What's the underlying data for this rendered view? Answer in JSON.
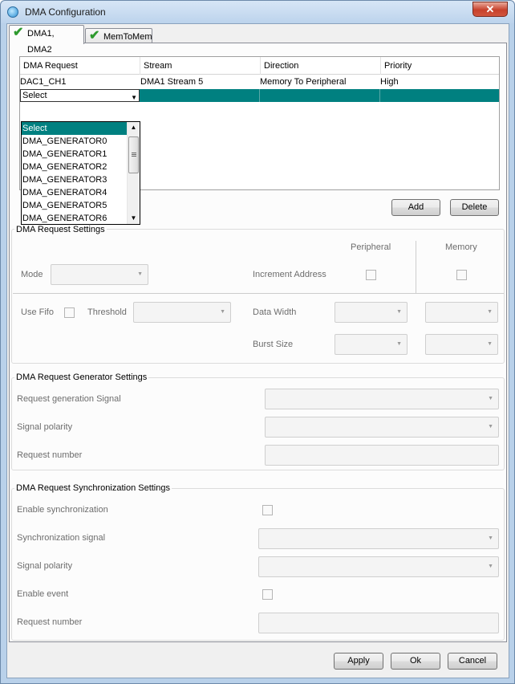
{
  "window": {
    "title": "DMA Configuration",
    "close_glyph": "✕"
  },
  "tabs": [
    {
      "label": "DMA1, DMA2",
      "icon": "check-icon",
      "active": true
    },
    {
      "label": "MemToMem",
      "icon": "check-icon",
      "active": false
    }
  ],
  "table": {
    "headers": [
      "DMA Request",
      "Stream",
      "Direction",
      "Priority"
    ],
    "rows": [
      {
        "request": "DAC1_CH1",
        "stream": "DMA1 Stream 5",
        "direction": "Memory To Peripheral",
        "priority": "High"
      }
    ],
    "editing_row": {
      "combo_value": "Select"
    }
  },
  "dropdown": {
    "options": [
      "Select",
      "DMA_GENERATOR0",
      "DMA_GENERATOR1",
      "DMA_GENERATOR2",
      "DMA_GENERATOR3",
      "DMA_GENERATOR4",
      "DMA_GENERATOR5",
      "DMA_GENERATOR6"
    ],
    "selected": "Select"
  },
  "table_buttons": {
    "add": "Add",
    "delete": "Delete"
  },
  "request_settings": {
    "title": "DMA Request Settings",
    "peripheral_header": "Peripheral",
    "memory_header": "Memory",
    "mode_label": "Mode",
    "increment_label": "Increment Address",
    "use_fifo_label": "Use Fifo",
    "threshold_label": "Threshold",
    "data_width_label": "Data Width",
    "burst_size_label": "Burst Size"
  },
  "generator_settings": {
    "title": "DMA Request Generator Settings",
    "signal_label": "Request generation Signal",
    "polarity_label": "Signal polarity",
    "number_label": "Request number"
  },
  "sync_settings": {
    "title": "DMA Request Synchronization Settings",
    "enable_sync_label": "Enable synchronization",
    "sync_signal_label": "Synchronization signal",
    "polarity_label": "Signal polarity",
    "enable_event_label": "Enable event",
    "number_label": "Request number"
  },
  "footer": {
    "apply": "Apply",
    "ok": "Ok",
    "cancel": "Cancel"
  }
}
